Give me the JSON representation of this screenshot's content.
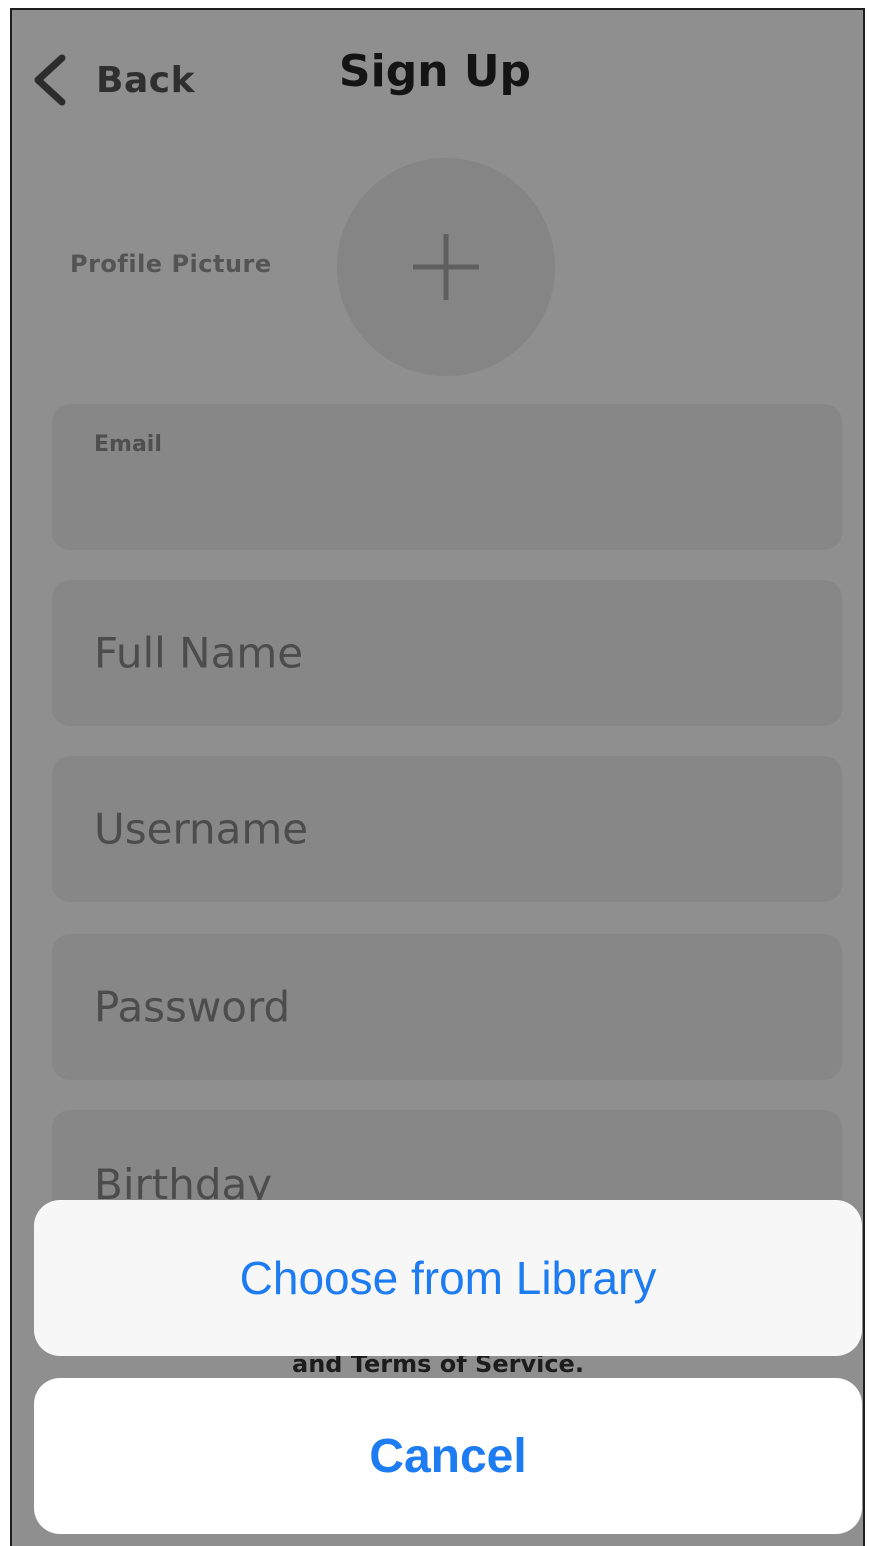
{
  "nav": {
    "back_label": "Back",
    "title": "Sign Up"
  },
  "profile": {
    "label": "Profile Picture",
    "add_icon": "plus-icon"
  },
  "fields": {
    "email_label": "Email",
    "fullname_placeholder": "Full Name",
    "username_placeholder": "Username",
    "password_placeholder": "Password",
    "birthday_placeholder": "Birthday"
  },
  "terms": {
    "partial_text": "and Terms of Service."
  },
  "action_sheet": {
    "library_label": "Choose from Library",
    "cancel_label": "Cancel"
  },
  "colors": {
    "action_blue": "#1e7cf2",
    "dim_overlay": "#8f8f8f"
  }
}
